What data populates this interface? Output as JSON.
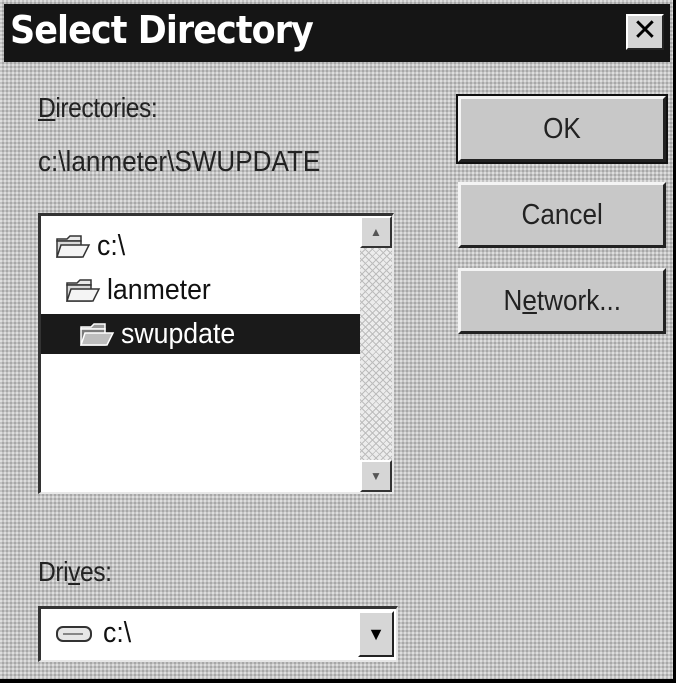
{
  "window": {
    "title": "Select Directory",
    "close_glyph": "✕"
  },
  "directories": {
    "label_underlined": "D",
    "label_rest": "irectories:",
    "current_path": "c:\\lanmeter\\SWUPDATE",
    "items": [
      {
        "label": "c:\\",
        "icon": "open-folder-icon",
        "selected": false
      },
      {
        "label": "lanmeter",
        "icon": "open-folder-icon",
        "selected": false
      },
      {
        "label": "swupdate",
        "icon": "open-folder-icon",
        "selected": true
      }
    ]
  },
  "drives": {
    "label_before": "Dri",
    "label_underlined": "v",
    "label_after": "es:",
    "selected_value": "c:\\",
    "icon": "hard-drive-icon"
  },
  "buttons": {
    "ok": "OK",
    "cancel": "Cancel",
    "network_before": "N",
    "network_underlined": "e",
    "network_after": "twork..."
  },
  "scrollbar": {
    "up_glyph": "▲",
    "down_glyph": "▼"
  },
  "combo_arrow_glyph": "▼",
  "colors": {
    "dialog_face": "#c3c3c3",
    "titlebar": "#151515",
    "selection": "#1a1a1a"
  }
}
